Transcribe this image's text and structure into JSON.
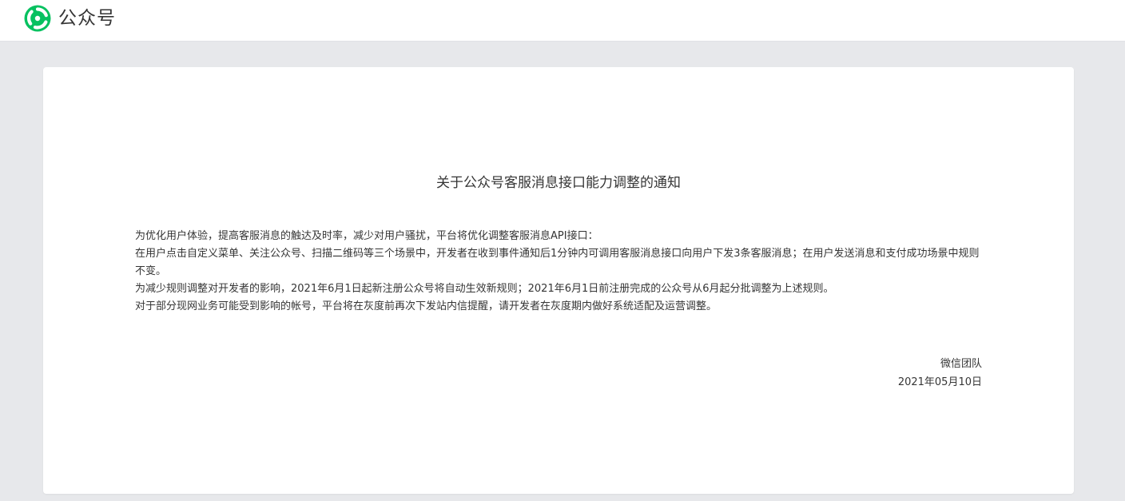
{
  "header": {
    "logo_text": "公众号",
    "logo_icon": "wechat-official-accounts-logo-icon",
    "accent_color": "#07c160"
  },
  "notice": {
    "title": "关于公众号客服消息接口能力调整的通知",
    "paragraphs": [
      "为优化用户体验，提高客服消息的触达及时率，减少对用户骚扰，平台将优化调整客服消息API接口：",
      "在用户点击自定义菜单、关注公众号、扫描二维码等三个场景中，开发者在收到事件通知后1分钟内可调用客服消息接口向用户下发3条客服消息；在用户发送消息和支付成功场景中规则不变。",
      "为减少规则调整对开发者的影响，2021年6月1日起新注册公众号将自动生效新规则；2021年6月1日前注册完成的公众号从6月起分批调整为上述规则。",
      "对于部分现网业务可能受到影响的帐号，平台将在灰度前再次下发站内信提醒，请开发者在灰度期内做好系统适配及运营调整。"
    ],
    "signature": "微信团队",
    "date": "2021年05月10日"
  }
}
